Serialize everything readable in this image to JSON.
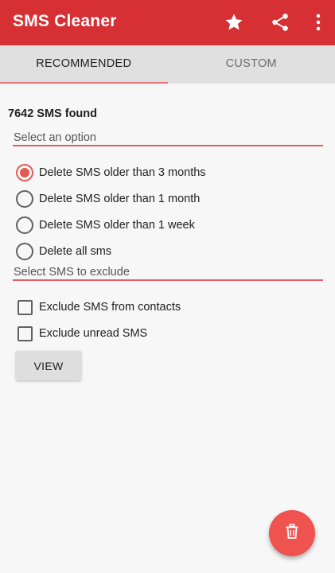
{
  "app": {
    "title": "SMS Cleaner",
    "accent_color": "#d62f34",
    "actions": [
      {
        "name": "favorite",
        "icon": "star-icon"
      },
      {
        "name": "share",
        "icon": "share-icon"
      },
      {
        "name": "more",
        "icon": "more-vertical-icon"
      }
    ]
  },
  "tabs": [
    {
      "label": "RECOMMENDED",
      "selected": true
    },
    {
      "label": "CUSTOM",
      "selected": false
    }
  ],
  "content": {
    "sms_count": "7642 SMS found",
    "select_option_header": "Select an option",
    "options": [
      {
        "label": "Delete SMS older than 3 months",
        "checked": true
      },
      {
        "label": "Delete SMS older than 1 month",
        "checked": false
      },
      {
        "label": "Delete SMS older than 1 week",
        "checked": false
      },
      {
        "label": "Delete all sms",
        "checked": false
      }
    ],
    "exclude_header": "Select SMS to exclude",
    "excludes": [
      {
        "label": "Exclude SMS from contacts",
        "checked": false
      },
      {
        "label": "Exclude unread SMS",
        "checked": false
      }
    ],
    "view_button": "VIEW"
  },
  "fab": {
    "icon": "trash-icon",
    "color": "#ef5350"
  }
}
